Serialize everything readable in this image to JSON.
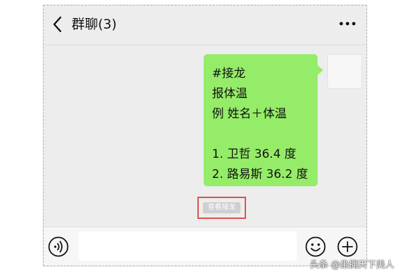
{
  "header": {
    "title": "群聊(3)",
    "back_icon": "chevron-left-icon",
    "more_icon": "more-dots-icon"
  },
  "message": {
    "lines": [
      "#接龙",
      "报体温",
      "例 姓名＋体温",
      "",
      "1. 卫哲 36.4 度",
      "2. 路易斯 36.2 度"
    ],
    "bubble_color": "#95ec69",
    "view_button_label": "查看接龙",
    "highlight_color": "#d9534f"
  },
  "input_bar": {
    "value": "",
    "voice_icon": "voice-icon",
    "emoji_icon": "emoji-icon",
    "plus_icon": "plus-icon"
  },
  "watermark": "头条 @坐拥天下美人"
}
